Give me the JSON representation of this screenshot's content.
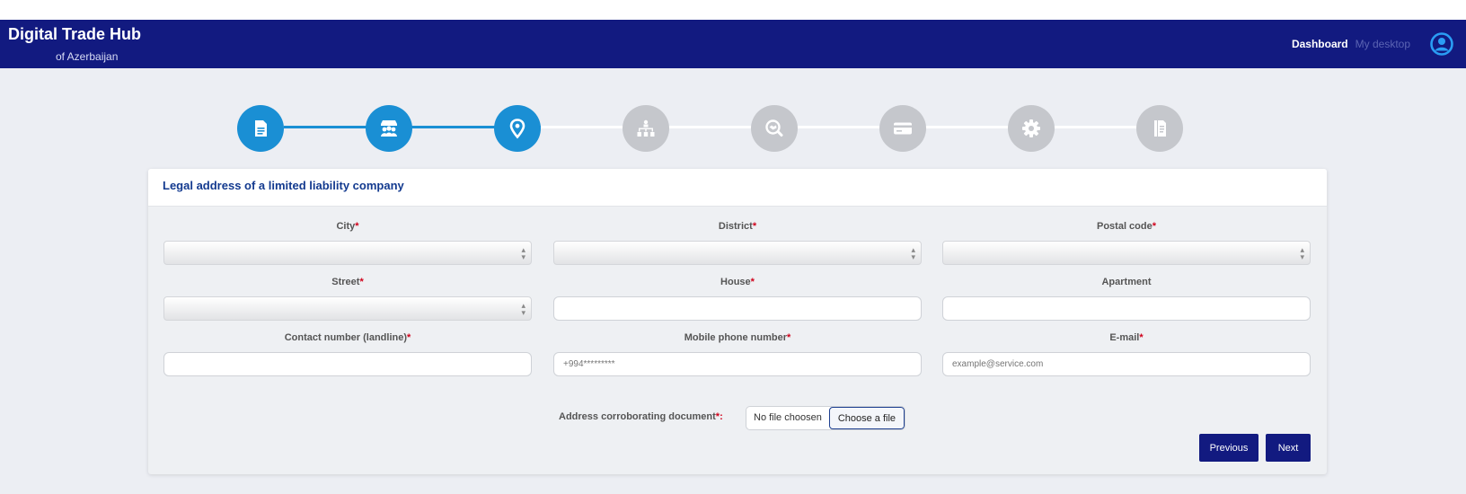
{
  "header": {
    "title": "Digital Trade Hub",
    "subtitle": "of Azerbaijan",
    "nav": {
      "dashboard": "Dashboard",
      "desktop": "My desktop"
    },
    "user_icon": "user-circle-icon"
  },
  "stepper": {
    "active_color": "#1a8fd4",
    "inactive_color": "#c5c7cc",
    "steps": [
      {
        "icon": "document-icon",
        "state": "completed"
      },
      {
        "icon": "people-store-icon",
        "state": "completed"
      },
      {
        "icon": "location-pin-icon",
        "state": "current"
      },
      {
        "icon": "org-chart-icon",
        "state": "pending"
      },
      {
        "icon": "magnifier-handshake-icon",
        "state": "pending"
      },
      {
        "icon": "credit-card-icon",
        "state": "pending"
      },
      {
        "icon": "gear-icon",
        "state": "pending"
      },
      {
        "icon": "ledger-icon",
        "state": "pending"
      }
    ]
  },
  "form": {
    "title": "Legal address of a limited liability company",
    "city": {
      "label": "City",
      "required": "*",
      "value": ""
    },
    "district": {
      "label": "District",
      "required": "*",
      "value": ""
    },
    "postal_code": {
      "label": "Postal code",
      "required": "*",
      "value": ""
    },
    "street": {
      "label": "Street",
      "required": "*",
      "value": ""
    },
    "house": {
      "label": "House",
      "required": "*",
      "value": ""
    },
    "apartment": {
      "label": "Apartment",
      "required": "",
      "value": ""
    },
    "landline": {
      "label": "Contact number (landline)",
      "required": "*",
      "value": ""
    },
    "mobile": {
      "label": "Mobile phone number",
      "required": "*",
      "placeholder": "+994*********"
    },
    "email": {
      "label": "E-mail",
      "required": "*",
      "placeholder": "example@service.com"
    },
    "document": {
      "label": "Address corroborating document",
      "required": "*:",
      "file_status": "No file choosen",
      "choose_label": "Choose a file"
    }
  },
  "actions": {
    "previous": "Previous",
    "next": "Next"
  }
}
